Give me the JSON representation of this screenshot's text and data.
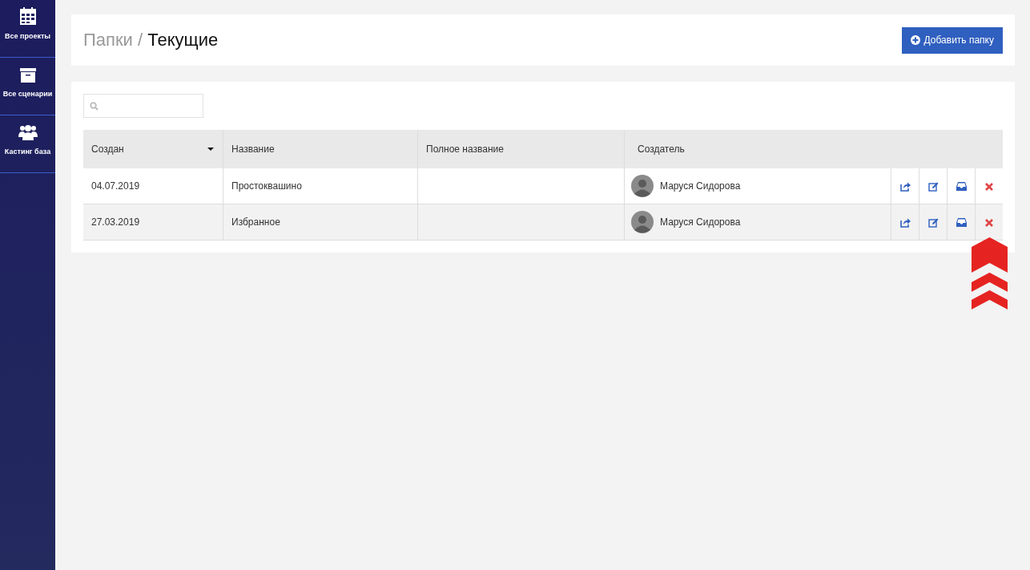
{
  "sidebar": {
    "items": [
      {
        "label": "Все проекты"
      },
      {
        "label": "Все сценарии"
      },
      {
        "label": "Кастинг база"
      }
    ]
  },
  "header": {
    "breadcrumb_parent": "Папки /",
    "title": "Текущие",
    "add_button": "Добавить папку"
  },
  "table": {
    "columns": [
      {
        "label": "Создан",
        "sorted": true
      },
      {
        "label": "Название",
        "sorted": false
      },
      {
        "label": "Полное название",
        "sorted": false
      },
      {
        "label": "Создатель",
        "sorted": false
      }
    ],
    "rows": [
      {
        "created": "04.07.2019",
        "name": "Простоквашино",
        "creator": "Маруся Сидорова"
      },
      {
        "created": "27.03.2019",
        "name": "Избранное",
        "creator": "Маруся Сидорова"
      }
    ]
  }
}
